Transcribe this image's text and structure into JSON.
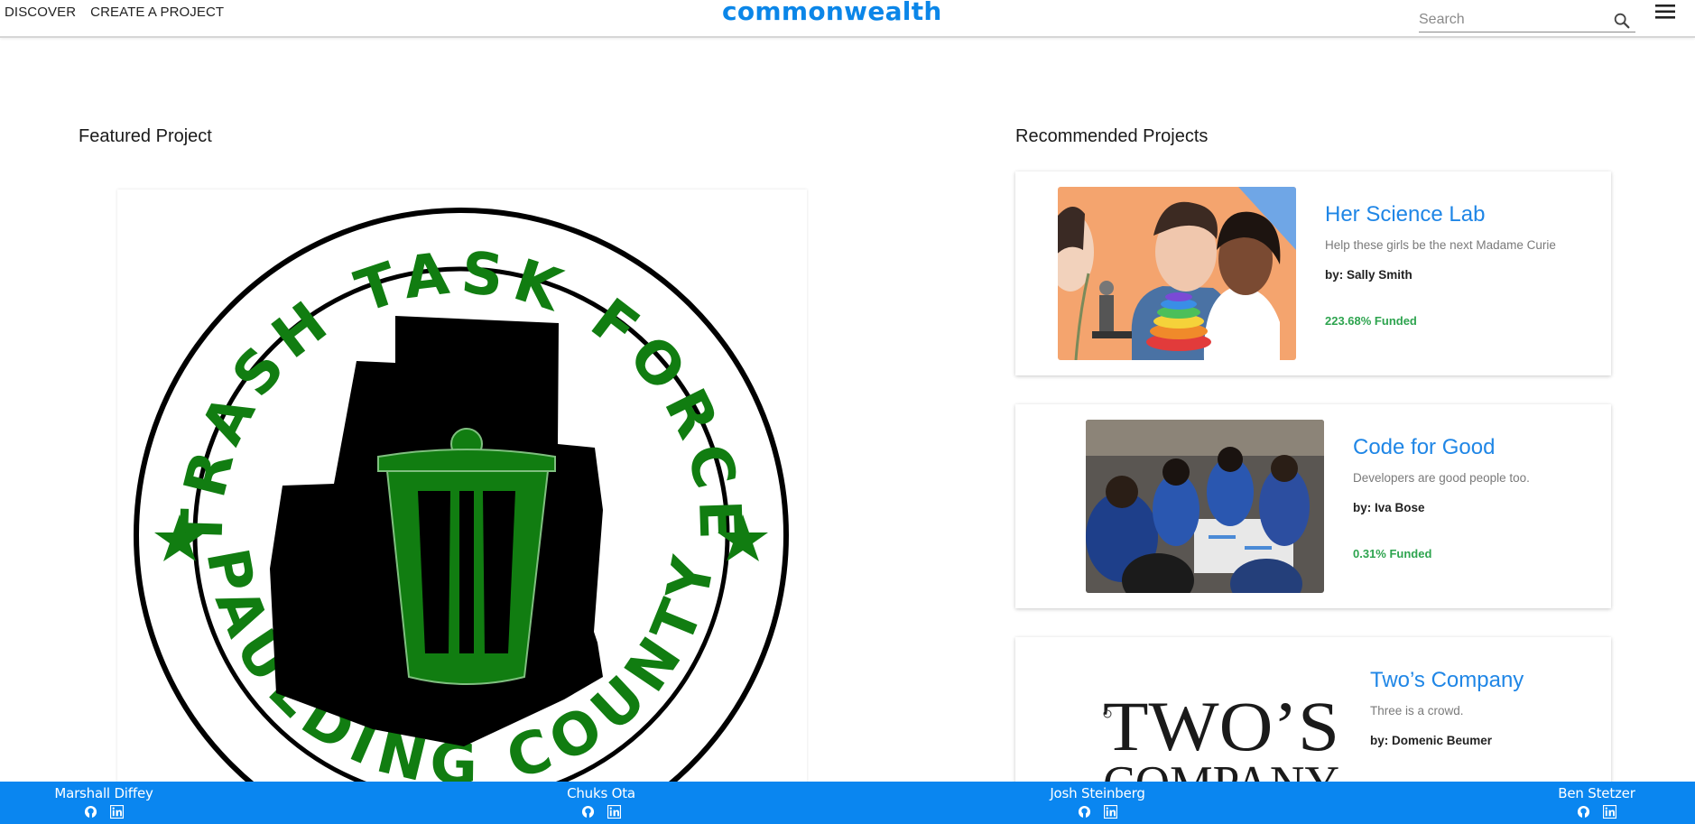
{
  "header": {
    "nav": [
      "DISCOVER",
      "CREATE A PROJECT"
    ],
    "logo": "commonwealth",
    "search_placeholder": "Search"
  },
  "featured": {
    "section_title": "Featured Project",
    "logo_text_top": "TRASH TASK FORCE",
    "logo_text_bottom": "PAULDING COUNTY"
  },
  "recommended": {
    "section_title": "Recommended Projects",
    "projects": [
      {
        "title": "Her Science Lab",
        "description": "Help these girls be the next Madame Curie",
        "author": "by: Sally Smith",
        "funded": "223.68% Funded"
      },
      {
        "title": "Code for Good",
        "description": "Developers are good people too.",
        "author": "by: Iva Bose",
        "funded": "0.31% Funded"
      },
      {
        "title": "Two’s Company",
        "description": "Three is a crowd.",
        "author": "by: Domenic Beumer",
        "funded": ""
      }
    ]
  },
  "two_company_image_text": "TWO’S COMPANY",
  "footer": {
    "members": [
      "Marshall Diffey",
      "Chuks Ota",
      "Josh Steinberg",
      "Ben Stetzer"
    ]
  },
  "colors": {
    "brand": "#0b86e8",
    "footer": "#0a86f0",
    "funded": "#2ea44f",
    "logo_green": "#117d11"
  }
}
